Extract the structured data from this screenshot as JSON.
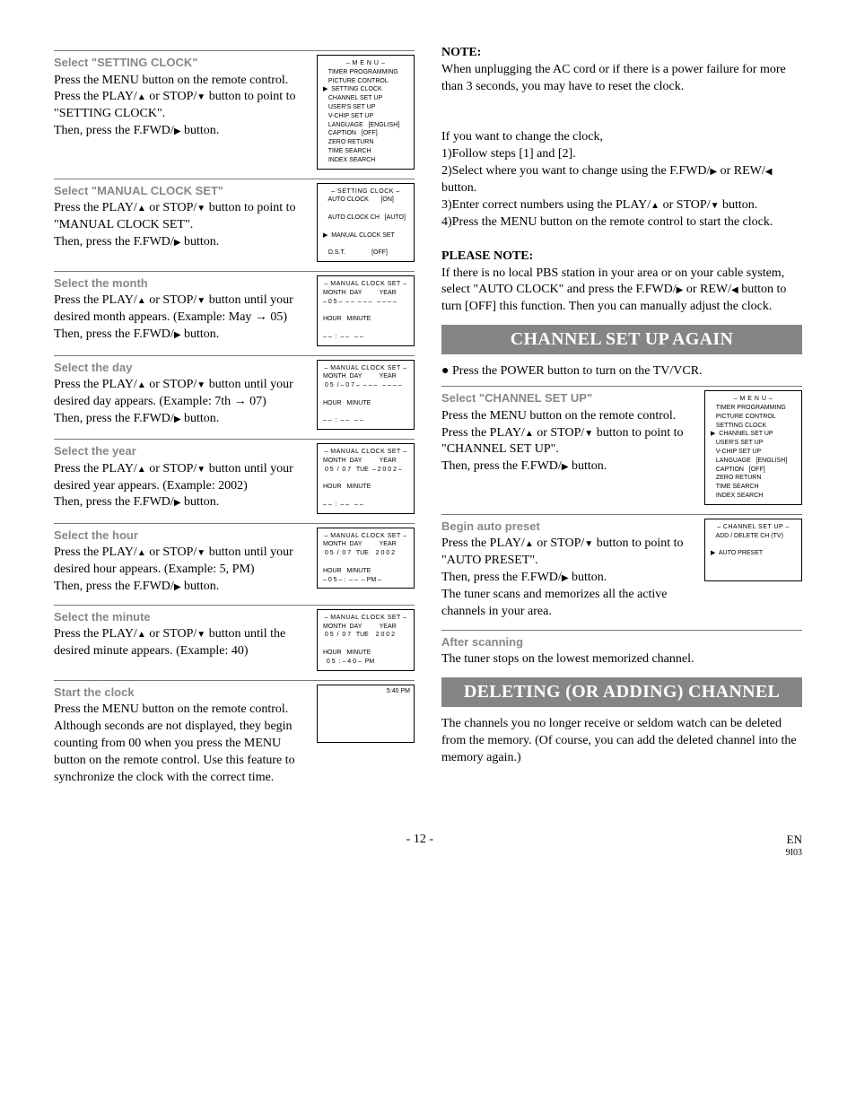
{
  "left": {
    "s1": {
      "head": "Select \"SETTING CLOCK\"",
      "l1": "Press the MENU button on the remote control. Press the PLAY/",
      "l2": " or STOP/",
      "l3": " button to point to \"SETTING CLOCK\".",
      "l4": "Then, press the F.FWD/",
      "l5": " button."
    },
    "osd1_title": "– M E N U –",
    "osd1_body": "   TIMER PROGRAMMING\n   PICTURE CONTROL\n▶  SETTING CLOCK\n   CHANNEL SET UP\n   USER'S SET UP\n   V-CHIP SET UP\n   LANGUAGE   [ENGLISH]\n   CAPTION   [OFF]\n   ZERO RETURN\n   TIME SEARCH\n   INDEX SEARCH",
    "s2": {
      "head": "Select \"MANUAL CLOCK SET\"",
      "l1": "Press the PLAY/",
      "l2": " or STOP/",
      "l3": " button to point to \"MANUAL CLOCK SET\".",
      "l4": "Then, press the F.FWD/",
      "l5": " button."
    },
    "osd2_title": "– SETTING CLOCK –",
    "osd2_body": "   AUTO CLOCK       [ON]\n\n   AUTO CLOCK CH   [AUTO]\n\n▶  MANUAL CLOCK SET\n\n   D.S.T.               [OFF]",
    "s3": {
      "head": "Select the month",
      "l1": "Press the PLAY/",
      "l2": " or STOP/",
      "l3": " button until your desired month appears. (Example: May → 05)",
      "l4": "Then, press the F.FWD/",
      "l5": " button."
    },
    "osd3_title": "– MANUAL CLOCK SET –",
    "osd3_body": "MONTH  DAY          YEAR\n– 0 5 –  – –  – – –   – – – –\n\nHOUR   MINUTE\n\n– –  :  – –   – –",
    "s4": {
      "head": "Select the day",
      "l1": "Press the PLAY/",
      "l2": " or STOP/",
      "l3": " button until your desired day appears. (Example: 7th → 07)",
      "l4": "Then, press the F.FWD/",
      "l5": " button."
    },
    "osd4_body": "MONTH  DAY          YEAR\n 0 5  / – 0 7 –  – – –   – – – –\n\nHOUR   MINUTE\n\n– –  :  – –   – –",
    "s5": {
      "head": "Select the year",
      "l1": "Press the PLAY/",
      "l2": " or STOP/",
      "l3": " button until your desired year appears. (Example: 2002)",
      "l4": "Then, press the F.FWD/",
      "l5": " button."
    },
    "osd5_body": "MONTH  DAY          YEAR\n 0 5  /  0 7   TUE  – 2 0 0 2 –\n\nHOUR   MINUTE\n\n– –  :  – –   – –",
    "s6": {
      "head": "Select the hour",
      "l1": "Press the PLAY/",
      "l2": " or STOP/",
      "l3": " button until your desired hour appears. (Example: 5, PM)",
      "l4": "Then, press the F.FWD/",
      "l5": " button."
    },
    "osd6_body": "MONTH  DAY          YEAR\n 0 5  /  0 7   TUE    2 0 0 2\n\nHOUR   MINUTE\n– 0 5 – :  – –  – PM –",
    "s7": {
      "head": "Select the minute",
      "l1": "Press the PLAY/",
      "l2": " or STOP/",
      "l3": " button until the desired minute appears. (Example: 40)"
    },
    "osd7_body": "MONTH  DAY          YEAR\n 0 5  /  0 7   TUE    2 0 0 2\n\nHOUR   MINUTE\n  0 5  : – 4 0 –  PM",
    "s8": {
      "head": "Start the clock",
      "time": "5:40 PM",
      "l1": "Press the MENU button on the remote control.",
      "l2": "Although seconds are not displayed, they begin counting from 00 when you press the MENU button on the remote control. Use this feature to synchronize the clock with the correct time."
    }
  },
  "right": {
    "note_h": "NOTE:",
    "note_b": "When unplugging the AC cord or if there is a power failure for more than 3 seconds, you may have to reset the clock.",
    "change_intro": "If you want to change the clock,",
    "c1": "1)Follow steps [1] and [2].",
    "c2a": "2)Select where you want to change using the F.FWD/",
    "c2b": " or REW/",
    "c2c": " button.",
    "c3a": "3)Enter correct numbers using the PLAY/",
    "c3b": " or STOP/",
    "c3c": " button.",
    "c4": "4)Press the MENU button on the remote control to start the clock.",
    "please_h": "PLEASE NOTE:",
    "please_a": "If there is no local PBS station in your area or on your cable system, select \"AUTO CLOCK\" and press the F.FWD/",
    "please_b": " or REW/",
    "please_c": " button to turn [OFF] this function. Then you can manually adjust the clock.",
    "bar1": "CHANNEL SET UP AGAIN",
    "power": "Press the POWER button to turn on the TV/VCR.",
    "cs1": {
      "head": "Select \"CHANNEL SET UP\"",
      "l1": "Press the MENU button on the remote control.",
      "l2a": "Press the PLAY/",
      "l2b": " or STOP/",
      "l2c": " button to point to \"CHANNEL SET UP\".",
      "l3a": "Then, press the F.FWD/",
      "l3b": " button."
    },
    "osd_cs1_title": "– M E N U –",
    "osd_cs1_body": "   TIMER PROGRAMMING\n   PICTURE CONTROL\n   SETTING CLOCK\n▶  CHANNEL SET UP\n   USER'S SET UP\n   V-CHIP SET UP\n   LANGUAGE   [ENGLISH]\n   CAPTION   [OFF]\n   ZERO RETURN\n   TIME SEARCH\n   INDEX SEARCH",
    "cs2": {
      "head": "Begin auto preset",
      "l1a": "Press the PLAY/",
      "l1b": " or STOP/",
      "l1c": " button to point to \"AUTO PRESET\".",
      "l2a": "Then, press the F.FWD/",
      "l2b": " button.",
      "l3": "The tuner scans and memorizes all the active channels in your area."
    },
    "osd_cs2_title": "– CHANNEL SET UP –",
    "osd_cs2_body": "   ADD / DELETE CH (TV)\n\n▶  AUTO PRESET",
    "cs3": {
      "head": "After scanning",
      "l1": "The tuner stops on the lowest memorized channel."
    },
    "bar2": "DELETING (OR ADDING) CHANNEL",
    "del": "The channels you no longer receive or seldom watch can be deleted from the memory. (Of course, you can add the deleted channel into the memory again.)"
  },
  "footer": {
    "page": "- 12 -",
    "lang": "EN",
    "code": "9I03"
  }
}
